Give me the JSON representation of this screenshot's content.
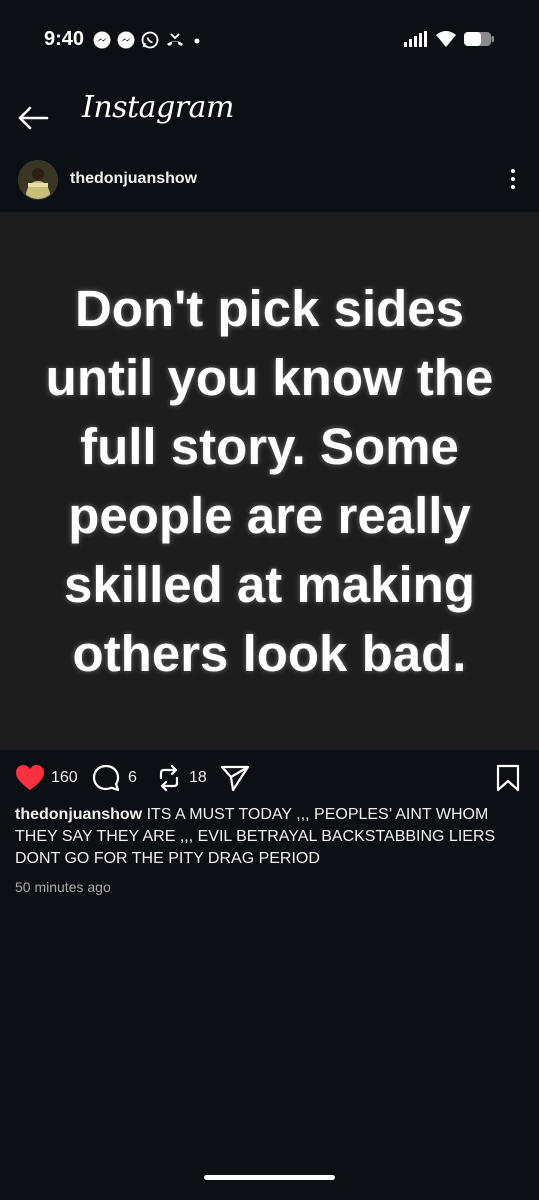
{
  "status_bar": {
    "time": "9:40",
    "icons_left": [
      "messenger-icon",
      "messenger-icon",
      "whatsapp-icon",
      "missed-call-icon",
      "dot-icon"
    ],
    "icons_right": [
      "signal-icon",
      "wifi-icon",
      "battery-icon"
    ]
  },
  "header": {
    "title": "Instagram",
    "back_icon": "arrow-left-icon"
  },
  "post": {
    "username": "thedonjuanshow",
    "image_text": "Don't pick sides until you know the full story. Some people are really skilled at making others look bad.",
    "likes": "160",
    "comments": "6",
    "reposts": "18",
    "caption_user": "thedonjuanshow",
    "caption_text": "ITS A MUST TODAY ,,, PEOPLES’ AINT WHOM THEY SAY THEY ARE ,,, EVIL BETRAYAL BACKSTABBING LIERS DONT GO FOR THE PITY DRAG PERIOD",
    "timestamp": "50 minutes ago"
  },
  "colors": {
    "background": "#0c1014",
    "image_background": "#1d1d1d",
    "like_red": "#ff3040",
    "muted_text": "#a8a8a8"
  }
}
